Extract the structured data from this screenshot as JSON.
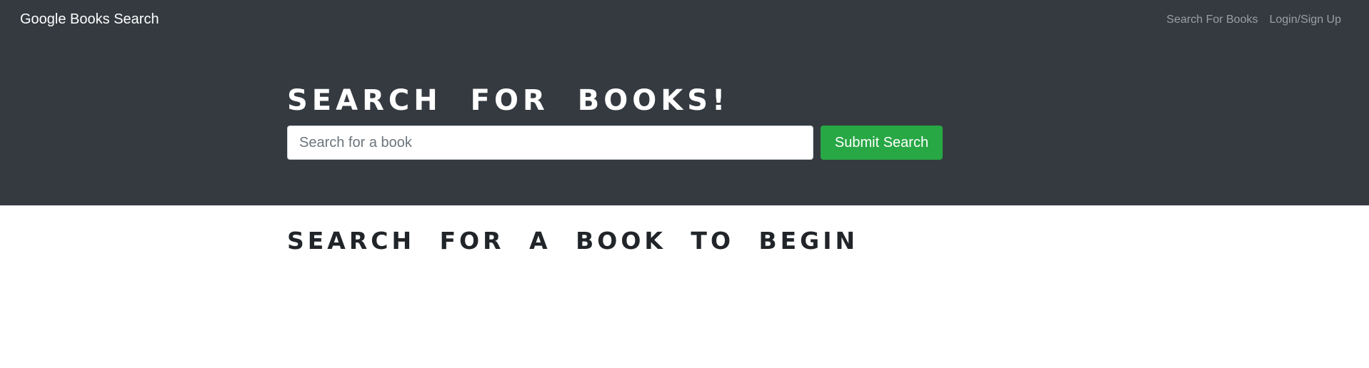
{
  "navbar": {
    "brand": "Google Books Search",
    "links": [
      {
        "label": "Search For Books"
      },
      {
        "label": "Login/Sign Up"
      }
    ]
  },
  "hero": {
    "title": "SEARCH FOR BOOKS!",
    "search": {
      "value": "",
      "placeholder": "Search for a book"
    },
    "submit_label": "Submit Search"
  },
  "main": {
    "heading": "SEARCH FOR A BOOK TO BEGIN"
  },
  "colors": {
    "navbar_bg": "#343a40",
    "submit_bg": "#28a745",
    "nav_link": "rgba(255,255,255,0.5)"
  }
}
